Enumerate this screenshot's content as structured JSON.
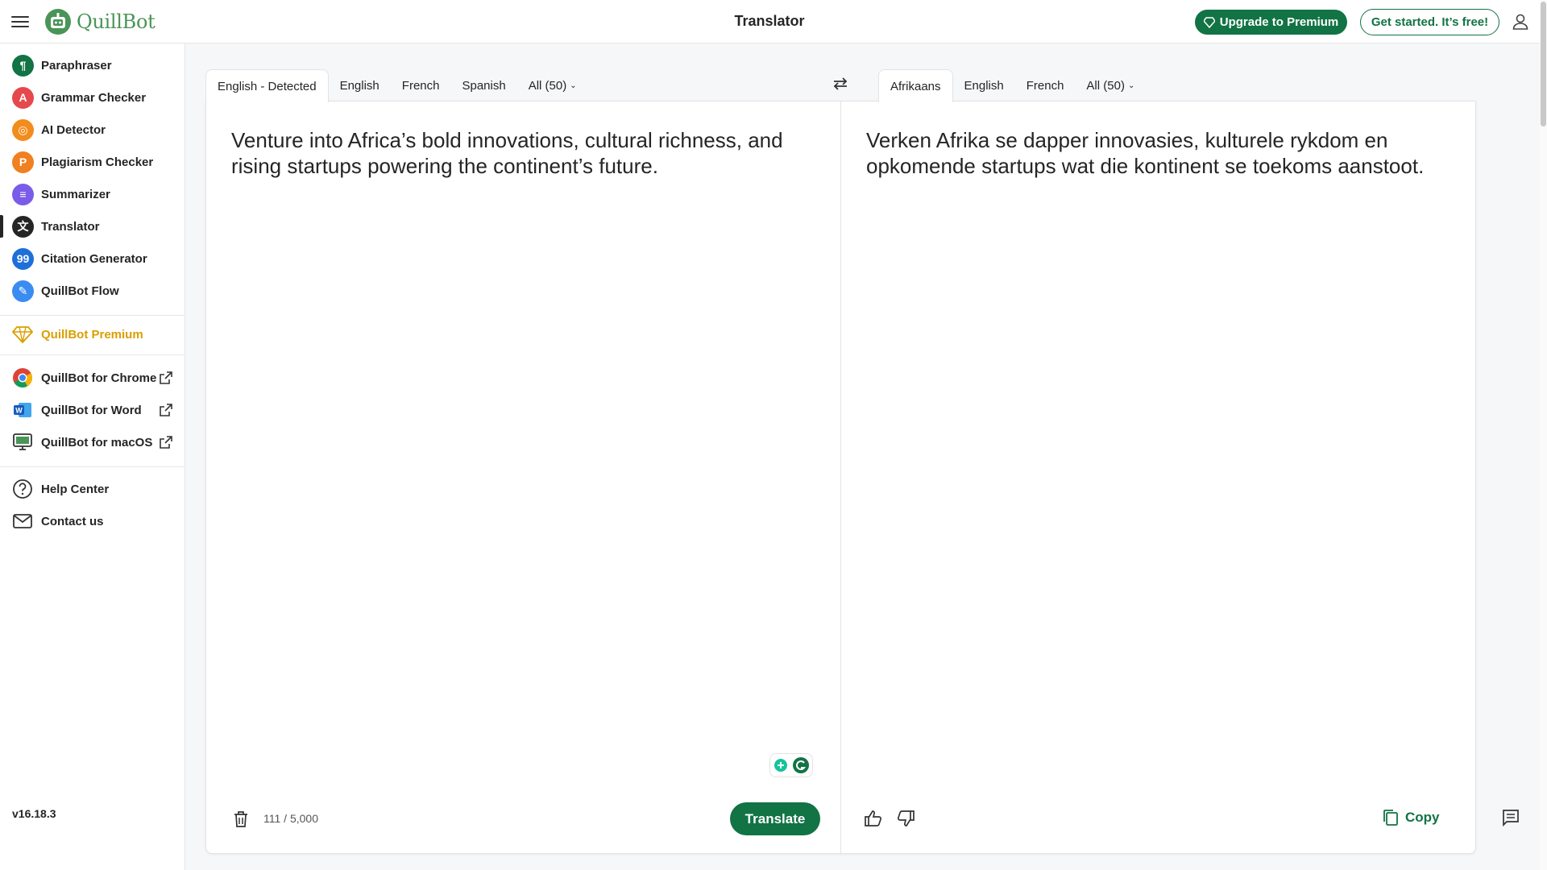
{
  "header": {
    "logo_text": "QuillBot",
    "title": "Translator",
    "upgrade_label": "Upgrade to Premium",
    "get_started_label": "Get started. It’s free!"
  },
  "sidebar": {
    "tools": [
      {
        "label": "Paraphraser",
        "color": "#127345"
      },
      {
        "label": "Grammar Checker",
        "color": "#e5484d"
      },
      {
        "label": "AI Detector",
        "color": "#f28c1c"
      },
      {
        "label": "Plagiarism Checker",
        "color": "#f08020"
      },
      {
        "label": "Summarizer",
        "color": "#7b5ce8"
      },
      {
        "label": "Translator",
        "color": "#252525"
      },
      {
        "label": "Citation Generator",
        "color": "#1e6fd9"
      },
      {
        "label": "QuillBot Flow",
        "color": "#3b8cf0"
      }
    ],
    "premium_label": "QuillBot Premium",
    "premium_color": "#d99f00",
    "extensions": [
      {
        "label": "QuillBot for Chrome"
      },
      {
        "label": "QuillBot for Word"
      },
      {
        "label": "QuillBot for macOS"
      }
    ],
    "help_label": "Help Center",
    "contact_label": "Contact us",
    "version": "v16.18.3"
  },
  "source": {
    "tabs": [
      "English - Detected",
      "English",
      "French",
      "Spanish",
      "All (50)"
    ],
    "active_tab": "English - Detected",
    "text": "Venture into Africa’s bold innovations, cultural richness, and rising startups powering the continent’s future.",
    "char_count": "111 / 5,000",
    "translate_label": "Translate"
  },
  "target": {
    "tabs": [
      "Afrikaans",
      "English",
      "French",
      "All (50)"
    ],
    "active_tab": "Afrikaans",
    "text": "Verken Afrika se dapper innovasies, kulturele rykdom en opkomende startups wat die kontinent se toekoms aanstoot.",
    "copy_label": "Copy"
  },
  "colors": {
    "brand_green": "#127345",
    "logo_green": "#499557"
  }
}
